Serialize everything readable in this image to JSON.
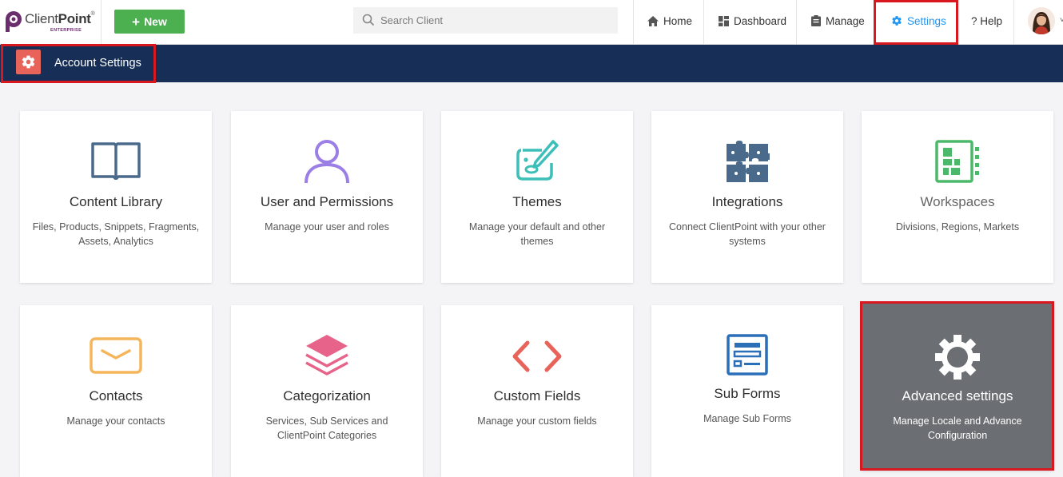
{
  "app": {
    "logo_text_light": "Client",
    "logo_text_bold": "Point",
    "logo_reg": "®",
    "logo_sub": "ENTERPRISE"
  },
  "header": {
    "new_label": "New",
    "search_placeholder": "Search Client",
    "nav": [
      {
        "label": "Home",
        "icon": "home-icon"
      },
      {
        "label": "Dashboard",
        "icon": "dashboard-icon"
      },
      {
        "label": "Manage",
        "icon": "clipboard-icon"
      },
      {
        "label": "Settings",
        "icon": "gear-icon",
        "active": true
      },
      {
        "label": "? Help",
        "icon": "help-icon"
      }
    ]
  },
  "banner": {
    "title": "Account Settings",
    "icon": "gear-icon"
  },
  "cards": [
    {
      "title": "Content Library",
      "desc": "Files, Products, Snippets, Fragments, Assets, Analytics",
      "icon": "book-icon",
      "color": "#4a6a8c"
    },
    {
      "title": "User and Permissions",
      "desc": "Manage your user and roles",
      "icon": "user-icon",
      "color": "#9b7fe6"
    },
    {
      "title": "Themes",
      "desc": "Manage your default and other themes",
      "icon": "palette-icon",
      "color": "#3bbfb8"
    },
    {
      "title": "Integrations",
      "desc": "Connect ClientPoint with your other systems",
      "icon": "puzzle-icon",
      "color": "#4a6a8c"
    },
    {
      "title": "Workspaces",
      "desc": "Divisions, Regions, Markets",
      "icon": "workspace-icon",
      "color": "#4cb86a"
    },
    {
      "title": "Contacts",
      "desc": "Manage your contacts",
      "icon": "envelope-icon",
      "color": "#f5b55a"
    },
    {
      "title": "Categorization",
      "desc": "Services, Sub Services and ClientPoint Categories",
      "icon": "layers-icon",
      "color": "#e8638a"
    },
    {
      "title": "Custom Fields",
      "desc": "Manage your custom fields",
      "icon": "code-icon",
      "color": "#e8635a"
    },
    {
      "title": "Sub Forms",
      "desc": "Manage Sub Forms",
      "icon": "form-icon",
      "color": "#2a6fb8"
    },
    {
      "title": "Advanced settings",
      "desc": "Manage Locale and Advance Configuration",
      "icon": "gear-icon",
      "color": "#ffffff",
      "highlighted": true
    }
  ],
  "colors": {
    "banner_bg": "#172f57",
    "new_button": "#4caf50",
    "accent": "#2196f3",
    "highlight_box": "#d8181e"
  }
}
